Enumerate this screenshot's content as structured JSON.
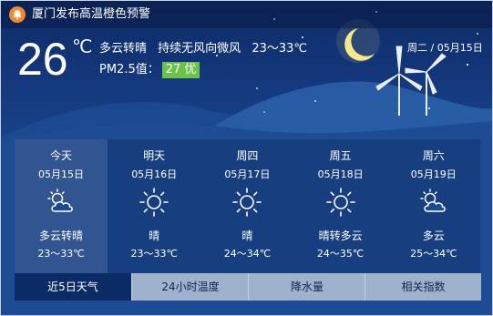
{
  "alert": {
    "text": "厦门发布高温橙色预警",
    "icon": "bell-icon",
    "color": "#f28a2d"
  },
  "current": {
    "temperature": "26",
    "unit": "℃",
    "condition": "多云转晴",
    "wind": "持续无风向微风",
    "range": "23～33℃",
    "pm_label": "PM2.5值：",
    "pm_value": "27 优",
    "pm_color": "#6ac24b",
    "date": "周二 / 05月15日"
  },
  "forecast": [
    {
      "name": "今天",
      "date": "05月15日",
      "icon": "partly-cloudy-icon",
      "condition": "多云转晴",
      "range": "23～33℃"
    },
    {
      "name": "明天",
      "date": "05月16日",
      "icon": "sun-icon",
      "condition": "晴",
      "range": "23～33℃"
    },
    {
      "name": "周四",
      "date": "05月17日",
      "icon": "sun-icon",
      "condition": "晴",
      "range": "24～34℃"
    },
    {
      "name": "周五",
      "date": "05月18日",
      "icon": "sun-icon",
      "condition": "晴转多云",
      "range": "24～35℃"
    },
    {
      "name": "周六",
      "date": "05月19日",
      "icon": "partly-cloudy-icon",
      "condition": "多云",
      "range": "25～34℃"
    }
  ],
  "tabs": [
    {
      "label": "近5日天气",
      "active": true
    },
    {
      "label": "24小时温度",
      "active": false
    },
    {
      "label": "降水量",
      "active": false
    },
    {
      "label": "相关指数",
      "active": false
    }
  ]
}
